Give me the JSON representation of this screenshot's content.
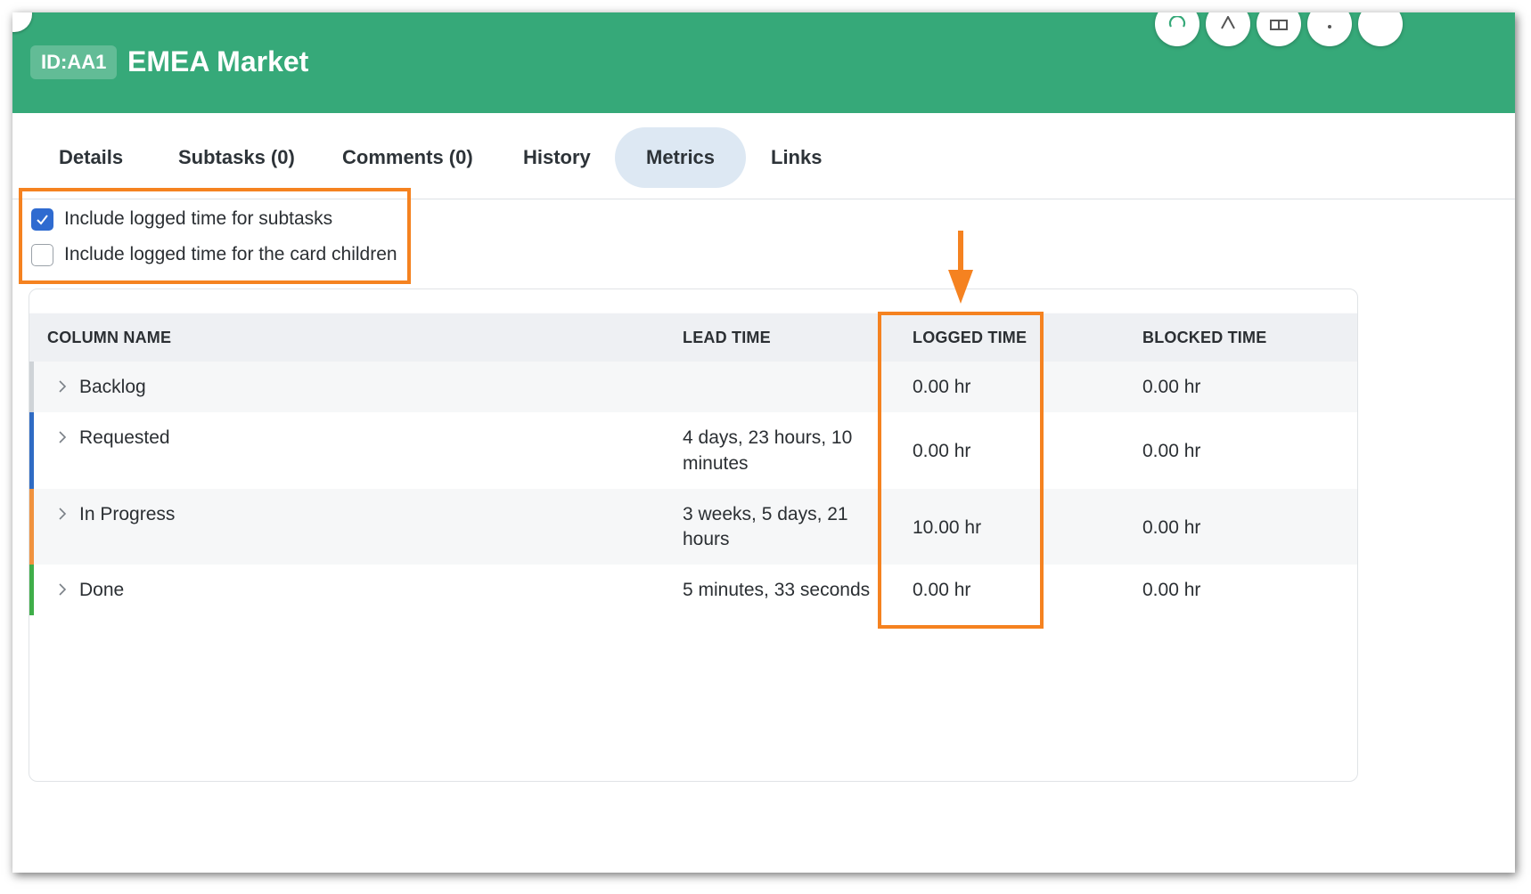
{
  "theme": {
    "accent": "#36a979",
    "highlight": "#f58220",
    "tab_active_bg": "#dde8f3"
  },
  "header": {
    "id_badge": "ID:AA1",
    "title": "EMEA Market"
  },
  "tabs": [
    {
      "label": "Details",
      "active": false
    },
    {
      "label": "Subtasks (0)",
      "active": false
    },
    {
      "label": "Comments (0)",
      "active": false
    },
    {
      "label": "History",
      "active": false
    },
    {
      "label": "Metrics",
      "active": true
    },
    {
      "label": "Links",
      "active": false
    }
  ],
  "options": [
    {
      "label": "Include logged time for subtasks",
      "checked": true
    },
    {
      "label": "Include logged time for the card children",
      "checked": false
    }
  ],
  "table": {
    "headers": {
      "column_name": "COLUMN NAME",
      "lead_time": "LEAD TIME",
      "logged_time": "LOGGED TIME",
      "blocked_time": "BLOCKED TIME"
    },
    "rows": [
      {
        "name": "Backlog",
        "lead_line1": "",
        "lead_line2": "",
        "logged": "0.00 hr",
        "blocked": "0.00 hr",
        "color": "#cfd3d7"
      },
      {
        "name": "Requested",
        "lead_line1": "4 days, 23 hours, 10",
        "lead_line2": "minutes",
        "logged": "0.00 hr",
        "blocked": "0.00 hr",
        "color": "#2f6bc4"
      },
      {
        "name": "In Progress",
        "lead_line1": "3 weeks, 5 days, 21",
        "lead_line2": "hours",
        "logged": "10.00 hr",
        "blocked": "0.00 hr",
        "color": "#f0923e"
      },
      {
        "name": "Done",
        "lead_line1": "5 minutes, 33 seconds",
        "lead_line2": "",
        "logged": "0.00 hr",
        "blocked": "0.00 hr",
        "color": "#3fae49"
      }
    ]
  }
}
